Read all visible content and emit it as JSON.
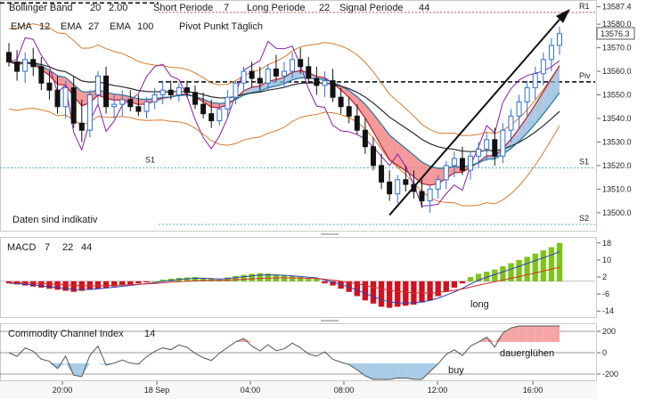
{
  "chart_data": [
    {
      "type": "candlestick",
      "panel": "price",
      "legend": {
        "bollinger": {
          "text": "Bollinger Band",
          "period": "20",
          "dev": "2.00",
          "color": "#d77a2c"
        },
        "macd_params": {
          "short_label": "Short Periode",
          "short": "7",
          "long_label": "Long Periode",
          "long": "22",
          "signal_label": "Signal Periode",
          "signal": "44"
        },
        "ema": [
          {
            "label": "EMA",
            "period": "12",
            "color": "#c0182c"
          },
          {
            "label": "EMA",
            "period": "27",
            "color": "#1f77a0"
          },
          {
            "label": "EMA",
            "period": "100",
            "color": "#2a2a2a"
          }
        ],
        "pivot": "Pivot Punkt Täglich"
      },
      "note": "Daten sind indikativ",
      "price_label": "13576.3",
      "y_ticks": [
        "13587.4",
        "13580.0",
        "13570.0",
        "13560.0",
        "13550.0",
        "13540.0",
        "13530.0",
        "13520.0",
        "13510.0",
        "13500.0"
      ],
      "ylim": [
        13495,
        13588
      ],
      "levels": [
        {
          "name": "R1",
          "value": 13585,
          "color": "#d0302c"
        },
        {
          "name": "Piv",
          "value": 13555.5,
          "color": "#111111"
        },
        {
          "name": "S1",
          "value": 13519,
          "color": "#2a9bb0"
        },
        {
          "name": "S2",
          "value": 13495,
          "color": "#2a9bb0"
        }
      ],
      "candles": [
        [
          13568,
          13572,
          13562,
          13564
        ],
        [
          13564,
          13569,
          13556,
          13560
        ],
        [
          13560,
          13568,
          13555,
          13565
        ],
        [
          13565,
          13570,
          13558,
          13562
        ],
        [
          13562,
          13566,
          13552,
          13555
        ],
        [
          13555,
          13560,
          13548,
          13552
        ],
        [
          13552,
          13558,
          13542,
          13545
        ],
        [
          13545,
          13556,
          13540,
          13553
        ],
        [
          13553,
          13558,
          13536,
          13538
        ],
        [
          13538,
          13548,
          13530,
          13535
        ],
        [
          13535,
          13552,
          13532,
          13550
        ],
        [
          13550,
          13560,
          13546,
          13558
        ],
        [
          13558,
          13562,
          13542,
          13545
        ],
        [
          13545,
          13550,
          13540,
          13546
        ],
        [
          13546,
          13552,
          13541,
          13548
        ],
        [
          13548,
          13552,
          13543,
          13545
        ],
        [
          13545,
          13550,
          13541,
          13543
        ],
        [
          13543,
          13549,
          13540,
          13547
        ],
        [
          13547,
          13553,
          13544,
          13550
        ],
        [
          13550,
          13556,
          13546,
          13552
        ],
        [
          13552,
          13556,
          13548,
          13550
        ],
        [
          13550,
          13555,
          13547,
          13553
        ],
        [
          13553,
          13556,
          13549,
          13551
        ],
        [
          13551,
          13554,
          13544,
          13546
        ],
        [
          13546,
          13551,
          13540,
          13542
        ],
        [
          13542,
          13548,
          13536,
          13539
        ],
        [
          13539,
          13546,
          13537,
          13544
        ],
        [
          13544,
          13552,
          13540,
          13549
        ],
        [
          13549,
          13556,
          13546,
          13555
        ],
        [
          13555,
          13562,
          13552,
          13560
        ],
        [
          13560,
          13564,
          13553,
          13557
        ],
        [
          13557,
          13562,
          13552,
          13555
        ],
        [
          13555,
          13563,
          13552,
          13561
        ],
        [
          13561,
          13567,
          13556,
          13558
        ],
        [
          13558,
          13564,
          13553,
          13560
        ],
        [
          13560,
          13568,
          13557,
          13565
        ],
        [
          13565,
          13570,
          13559,
          13562
        ],
        [
          13562,
          13566,
          13555,
          13557
        ],
        [
          13557,
          13562,
          13550,
          13554
        ],
        [
          13554,
          13560,
          13549,
          13556
        ],
        [
          13556,
          13561,
          13547,
          13549
        ],
        [
          13549,
          13553,
          13542,
          13545
        ],
        [
          13545,
          13549,
          13538,
          13541
        ],
        [
          13541,
          13546,
          13533,
          13535
        ],
        [
          13535,
          13540,
          13525,
          13528
        ],
        [
          13528,
          13532,
          13518,
          13520
        ],
        [
          13520,
          13525,
          13510,
          13513
        ],
        [
          13513,
          13518,
          13505,
          13508
        ],
        [
          13508,
          13516,
          13504,
          13514
        ],
        [
          13514,
          13520,
          13509,
          13512
        ],
        [
          13512,
          13518,
          13506,
          13509
        ],
        [
          13509,
          13514,
          13502,
          13505
        ],
        [
          13505,
          13512,
          13500,
          13510
        ],
        [
          13510,
          13516,
          13506,
          13514
        ],
        [
          13514,
          13522,
          13510,
          13520
        ],
        [
          13520,
          13526,
          13515,
          13523
        ],
        [
          13523,
          13528,
          13516,
          13518
        ],
        [
          13518,
          13526,
          13514,
          13524
        ],
        [
          13524,
          13530,
          13519,
          13527
        ],
        [
          13527,
          13534,
          13522,
          13531
        ],
        [
          13531,
          13536,
          13520,
          13524
        ],
        [
          13524,
          13538,
          13521,
          13535
        ],
        [
          13535,
          13544,
          13530,
          13541
        ],
        [
          13541,
          13550,
          13536,
          13547
        ],
        [
          13547,
          13556,
          13541,
          13553
        ],
        [
          13553,
          13562,
          13548,
          13559
        ],
        [
          13559,
          13568,
          13554,
          13565
        ],
        [
          13565,
          13574,
          13560,
          13571
        ],
        [
          13571,
          13579,
          13567,
          13576
        ]
      ],
      "trend_line": {
        "from": [
          13499,
          47
        ],
        "to": [
          13582,
          68
        ]
      }
    },
    {
      "type": "bar",
      "panel": "macd",
      "legend": {
        "label": "MACD",
        "short": "7",
        "long": "22",
        "signal": "44"
      },
      "y_ticks": [
        "18",
        "10",
        "2",
        "-6",
        "-14"
      ],
      "ylim": [
        -16,
        20
      ],
      "values": [
        -1,
        -1.5,
        -2,
        -2.5,
        -3,
        -3.5,
        -4,
        -4.5,
        -5,
        -4.5,
        -4,
        -3.5,
        -3,
        -2.5,
        -2,
        -1.5,
        -1,
        -0.5,
        0,
        0.8,
        1.2,
        1.6,
        1.8,
        2.0,
        1.6,
        1.2,
        0.8,
        1.8,
        2.5,
        3,
        3.5,
        3.8,
        3.6,
        3.2,
        2.8,
        2.4,
        2,
        1.6,
        1.2,
        -1,
        -2,
        -3.5,
        -5,
        -7,
        -9,
        -10.5,
        -12,
        -12.5,
        -12,
        -11.5,
        -11,
        -10,
        -9,
        -7,
        -5,
        -3,
        -1,
        2,
        3.5,
        4.5,
        5.5,
        7,
        8.5,
        10,
        11.5,
        13,
        14.5,
        16,
        18
      ],
      "annotation": "long"
    },
    {
      "type": "area",
      "panel": "cci",
      "legend": {
        "label": "Commodity Channel Index",
        "period": "14"
      },
      "y_ticks": [
        "200",
        "0",
        "-200"
      ],
      "ylim": [
        -250,
        250
      ],
      "annotations": [
        "buy",
        "dauerglühen"
      ]
    }
  ],
  "x_axis": {
    "ticks": [
      "20:00",
      "18 Sep",
      "04:00",
      "08:00",
      "12:00",
      "16:00"
    ]
  },
  "colors": {
    "bull": "#2f6fd1",
    "bear": "#111111",
    "macd_pos": "#7fc41b",
    "macd_neg": "#cf1220",
    "cloud_red": "#f0787a",
    "cloud_blue": "#8fb7d8"
  }
}
